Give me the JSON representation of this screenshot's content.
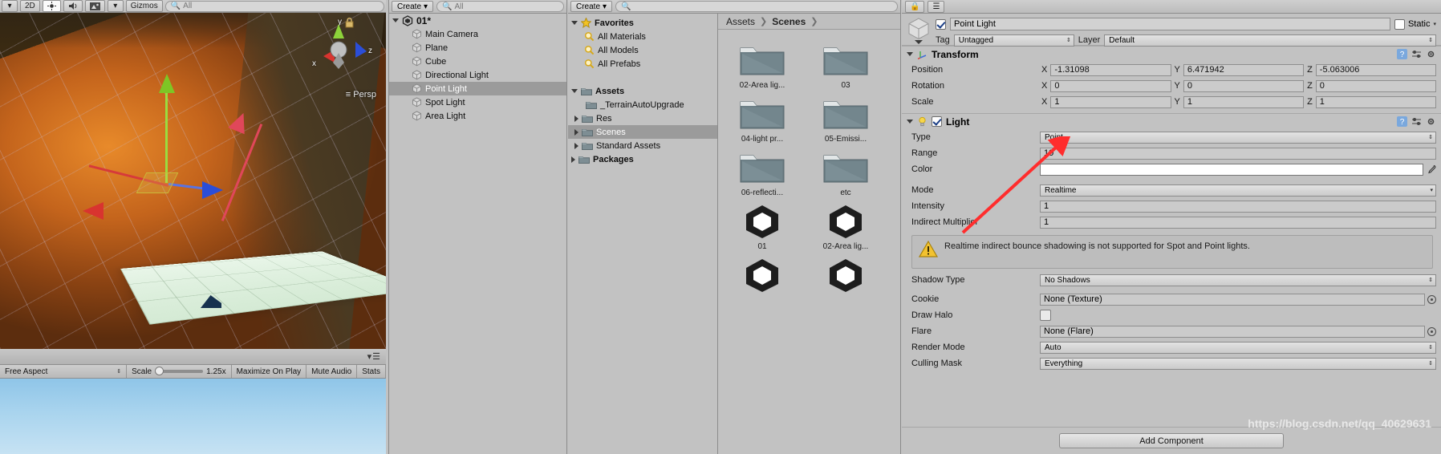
{
  "scene_view": {
    "toolbar": {
      "mode_2d": "2D",
      "lighting_icon": "lighting-icon",
      "audio_icon": "audio-icon",
      "fx_icon": "effects-icon",
      "gizmos": "Gizmos",
      "search_placeholder": "All"
    },
    "axis_labels": {
      "x": "x",
      "y": "y",
      "z": "z"
    },
    "camera_mode": "≡ Persp",
    "lock_icon": "lock-icon"
  },
  "game_view": {
    "aspect": "Free Aspect",
    "scale_label": "Scale",
    "scale_value": "1.25x",
    "maximize_on_play": "Maximize On Play",
    "mute_audio": "Mute Audio",
    "stats": "Stats"
  },
  "hierarchy": {
    "create_label": "Create",
    "search_placeholder": "All",
    "scene_name": "01*",
    "items": [
      {
        "label": "Main Camera",
        "selected": false
      },
      {
        "label": "Plane",
        "selected": false
      },
      {
        "label": "Cube",
        "selected": false
      },
      {
        "label": "Directional Light",
        "selected": false
      },
      {
        "label": "Point Light",
        "selected": true
      },
      {
        "label": "Spot Light",
        "selected": false
      },
      {
        "label": "Area Light",
        "selected": false
      }
    ]
  },
  "project": {
    "create_label": "Create",
    "search_placeholder": "",
    "tree": [
      {
        "label": "Favorites",
        "icon": "star-icon",
        "indent": 0,
        "bold": true,
        "arrow": "down",
        "selected": false
      },
      {
        "label": "All Materials",
        "icon": "search-icon",
        "indent": 1,
        "bold": false,
        "arrow": "none",
        "selected": false
      },
      {
        "label": "All Models",
        "icon": "search-icon",
        "indent": 1,
        "bold": false,
        "arrow": "none",
        "selected": false
      },
      {
        "label": "All Prefabs",
        "icon": "search-icon",
        "indent": 1,
        "bold": false,
        "arrow": "none",
        "selected": false
      },
      {
        "label": "",
        "icon": "none",
        "indent": 0,
        "bold": false,
        "arrow": "none",
        "selected": false
      },
      {
        "label": "Assets",
        "icon": "folder-icon",
        "indent": 0,
        "bold": true,
        "arrow": "down",
        "selected": false
      },
      {
        "label": "_TerrainAutoUpgrade",
        "icon": "folder-icon",
        "indent": 1,
        "bold": false,
        "arrow": "none",
        "selected": false
      },
      {
        "label": "Res",
        "icon": "folder-icon",
        "indent": 1,
        "bold": false,
        "arrow": "right",
        "selected": false
      },
      {
        "label": "Scenes",
        "icon": "folder-icon",
        "indent": 1,
        "bold": false,
        "arrow": "right",
        "selected": true
      },
      {
        "label": "Standard Assets",
        "icon": "folder-icon",
        "indent": 1,
        "bold": false,
        "arrow": "right",
        "selected": false
      },
      {
        "label": "Packages",
        "icon": "folder-icon",
        "indent": 0,
        "bold": true,
        "arrow": "right",
        "selected": false
      }
    ],
    "breadcrumb": {
      "root": "Assets",
      "current": "Scenes"
    },
    "assets": [
      {
        "label": "02-Area lig...",
        "type": "folder"
      },
      {
        "label": "03",
        "type": "folder"
      },
      {
        "label": "04-light pr...",
        "type": "folder"
      },
      {
        "label": "05-Emissi...",
        "type": "folder"
      },
      {
        "label": "06-reflecti...",
        "type": "folder"
      },
      {
        "label": "etc",
        "type": "folder"
      },
      {
        "label": "01",
        "type": "unity-scene"
      },
      {
        "label": "02-Area lig...",
        "type": "unity-scene"
      },
      {
        "label": "",
        "type": "unity-scene"
      },
      {
        "label": "",
        "type": "unity-scene"
      }
    ]
  },
  "inspector": {
    "object_name": "Point Light",
    "enabled": true,
    "static_label": "Static",
    "static_checked": false,
    "tag_label": "Tag",
    "tag_value": "Untagged",
    "layer_label": "Layer",
    "layer_value": "Default",
    "transform": {
      "title": "Transform",
      "rows": [
        {
          "label": "Position",
          "x": "-1.31098",
          "y": "6.471942",
          "z": "-5.063006"
        },
        {
          "label": "Rotation",
          "x": "0",
          "y": "0",
          "z": "0"
        },
        {
          "label": "Scale",
          "x": "1",
          "y": "1",
          "z": "1"
        }
      ],
      "axis": {
        "x": "X",
        "y": "Y",
        "z": "Z"
      }
    },
    "light": {
      "title": "Light",
      "enabled": true,
      "type_label": "Type",
      "type_value": "Point",
      "range_label": "Range",
      "range_value": "10",
      "color_label": "Color",
      "color_value": "#ffffff",
      "mode_label": "Mode",
      "mode_value": "Realtime",
      "intensity_label": "Intensity",
      "intensity_value": "1",
      "indirect_label": "Indirect Multiplier",
      "indirect_value": "1",
      "warning": "Realtime indirect bounce shadowing is not supported for Spot and Point lights.",
      "shadow_type_label": "Shadow Type",
      "shadow_type_value": "No Shadows",
      "cookie_label": "Cookie",
      "cookie_value": "None (Texture)",
      "draw_halo_label": "Draw Halo",
      "draw_halo_checked": false,
      "flare_label": "Flare",
      "flare_value": "None (Flare)",
      "render_mode_label": "Render Mode",
      "render_mode_value": "Auto",
      "culling_mask_label": "Culling Mask",
      "culling_mask_value": "Everything"
    },
    "add_component": "Add Component"
  },
  "watermark": "https://blog.csdn.net/qq_40629631",
  "colors": {
    "annotation_arrow": "#ff2d2d",
    "selection": "#9b9b9b",
    "panel_bg": "#c2c2c2"
  }
}
